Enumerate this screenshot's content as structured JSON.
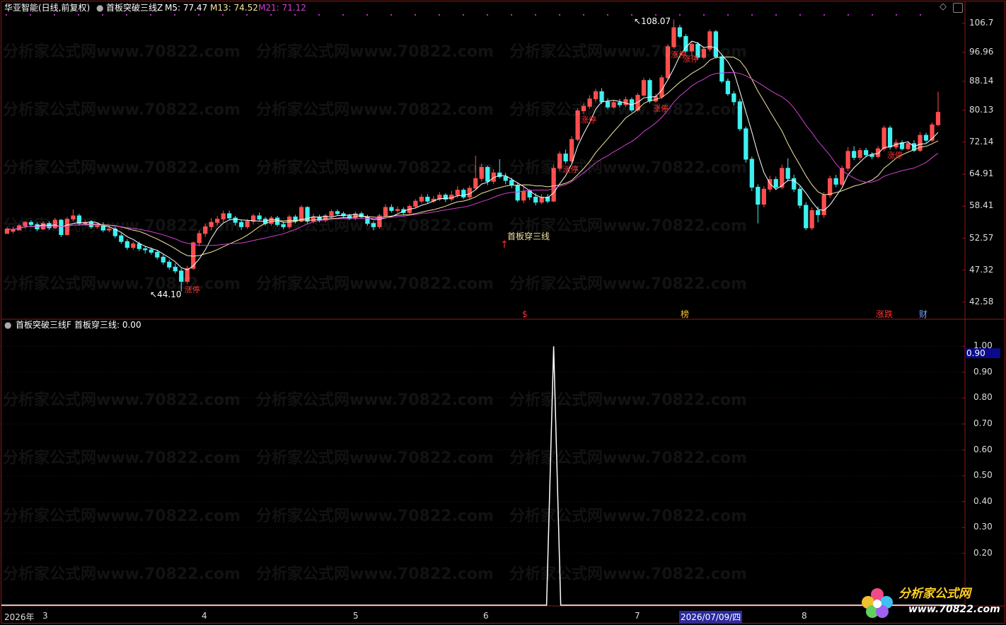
{
  "header": {
    "stock": "华亚智能(日线,前复权)",
    "indicator": "首板突破三线Z",
    "m5": "M5: 77.47",
    "m13": "M13: 74.52",
    "m21": "M21: 71.12"
  },
  "sub_header": {
    "indicator": "首板突破三线F",
    "value": "首板穿三线: 0.00"
  },
  "annotations": {
    "high": "108.07",
    "low": "44.10",
    "signal": "首板穿三线",
    "limit_up": "涨停",
    "marker_s": "$",
    "marker_bang": "榜",
    "marker_zd": "涨跌",
    "marker_cai": "财",
    "cursor_value": "0.90"
  },
  "watermark": "分析家公式网www.70822.com",
  "logo": {
    "text": "分析家公式网",
    "url": "www.70822.com"
  },
  "colors": {
    "up": "#ff4d4d",
    "down": "#3ef0f0",
    "m5": "#ffffff",
    "m13": "#f5e6a0",
    "m21": "#d040d0",
    "frame": "#8b1a1a"
  },
  "chart_data": [
    {
      "type": "candlestick",
      "title": "华亚智能(日线,前复权)",
      "ylim": [
        42.58,
        106.7
      ],
      "yticks": [
        "106.7",
        "96.96",
        "88.14",
        "80.13",
        "72.14",
        "64.91",
        "58.41",
        "52.57",
        "47.32",
        "42.58"
      ],
      "xticks": [
        "2026年",
        "3",
        "4",
        "5",
        "6",
        "7",
        "2026/07/09/四",
        "8"
      ],
      "series": [
        {
          "name": "M5",
          "last": 77.47
        },
        {
          "name": "M13",
          "last": 74.52
        },
        {
          "name": "M21",
          "last": 71.12
        }
      ],
      "candles": [
        [
          53.4,
          54.2,
          53.8,
          54.6
        ],
        [
          53.8,
          54.0,
          54.6,
          53.4
        ],
        [
          54.0,
          54.8,
          54.4,
          55.2
        ],
        [
          54.8,
          55.4,
          55.6,
          54.3
        ],
        [
          55.4,
          55.0,
          55.8,
          54.6
        ],
        [
          55.0,
          54.2,
          55.4,
          53.8
        ],
        [
          54.2,
          55.2,
          55.6,
          54.0
        ],
        [
          55.2,
          54.4,
          55.6,
          54.0
        ],
        [
          54.4,
          55.8,
          56.2,
          54.2
        ],
        [
          55.8,
          53.2,
          56.0,
          52.8
        ],
        [
          53.2,
          56.0,
          56.4,
          53.0
        ],
        [
          56.0,
          56.6,
          57.8,
          55.6
        ],
        [
          56.6,
          55.2,
          57.0,
          54.8
        ],
        [
          55.2,
          55.4,
          55.8,
          54.8
        ],
        [
          55.4,
          54.6,
          55.8,
          54.2
        ],
        [
          54.6,
          54.8,
          55.2,
          54.2
        ],
        [
          54.8,
          54.0,
          55.4,
          53.6
        ],
        [
          54.0,
          54.2,
          54.8,
          53.6
        ],
        [
          54.2,
          53.0,
          54.6,
          52.6
        ],
        [
          53.0,
          52.0,
          53.4,
          51.6
        ],
        [
          52.0,
          51.0,
          52.4,
          50.6
        ],
        [
          51.0,
          51.6,
          52.0,
          50.6
        ],
        [
          51.6,
          50.8,
          52.0,
          50.4
        ],
        [
          50.8,
          50.6,
          51.2,
          50.0
        ],
        [
          50.6,
          50.2,
          51.0,
          49.8
        ],
        [
          50.2,
          49.4,
          50.6,
          49.0
        ],
        [
          49.4,
          48.6,
          49.8,
          48.2
        ],
        [
          48.6,
          47.8,
          49.0,
          47.4
        ],
        [
          47.8,
          47.2,
          48.4,
          46.8
        ],
        [
          47.2,
          45.6,
          47.6,
          44.1
        ],
        [
          45.6,
          47.6,
          48.0,
          45.2
        ],
        [
          47.6,
          51.8,
          52.0,
          47.4
        ],
        [
          51.8,
          53.4,
          54.0,
          51.2
        ],
        [
          53.4,
          54.6,
          55.2,
          52.8
        ],
        [
          54.6,
          55.4,
          56.2,
          54.0
        ],
        [
          55.4,
          56.0,
          56.6,
          54.8
        ],
        [
          56.0,
          57.0,
          57.6,
          55.4
        ],
        [
          57.0,
          56.2,
          57.6,
          55.8
        ],
        [
          56.2,
          55.4,
          56.6,
          54.8
        ],
        [
          55.4,
          54.6,
          55.8,
          54.0
        ],
        [
          54.6,
          55.6,
          56.0,
          54.2
        ],
        [
          55.6,
          56.6,
          57.0,
          55.0
        ],
        [
          56.6,
          56.0,
          57.2,
          55.6
        ],
        [
          56.0,
          55.2,
          56.4,
          54.8
        ],
        [
          55.2,
          56.2,
          56.6,
          54.8
        ],
        [
          56.2,
          55.0,
          56.6,
          54.6
        ],
        [
          55.0,
          54.6,
          55.4,
          54.2
        ],
        [
          54.6,
          56.4,
          56.8,
          54.2
        ],
        [
          56.4,
          55.6,
          56.8,
          55.2
        ],
        [
          55.6,
          58.2,
          58.6,
          55.4
        ],
        [
          58.2,
          55.6,
          58.4,
          55.2
        ],
        [
          55.6,
          56.4,
          57.0,
          55.2
        ],
        [
          56.4,
          55.8,
          56.8,
          55.4
        ],
        [
          55.8,
          56.6,
          57.0,
          55.4
        ],
        [
          56.6,
          57.4,
          57.8,
          56.2
        ],
        [
          57.4,
          57.0,
          57.8,
          56.6
        ],
        [
          57.0,
          56.6,
          57.4,
          56.2
        ],
        [
          56.6,
          56.2,
          57.0,
          55.8
        ],
        [
          56.2,
          57.0,
          57.4,
          55.8
        ],
        [
          57.0,
          56.4,
          57.4,
          56.0
        ],
        [
          56.4,
          55.2,
          56.8,
          54.8
        ],
        [
          55.2,
          54.6,
          55.6,
          54.0
        ],
        [
          54.6,
          56.6,
          57.0,
          54.2
        ],
        [
          56.6,
          58.2,
          58.8,
          56.2
        ],
        [
          58.2,
          57.6,
          58.8,
          57.2
        ],
        [
          57.6,
          57.8,
          58.4,
          57.2
        ],
        [
          57.8,
          57.2,
          58.2,
          56.8
        ],
        [
          57.2,
          58.4,
          58.8,
          56.8
        ],
        [
          58.4,
          59.4,
          59.8,
          58.0
        ],
        [
          59.4,
          60.2,
          60.8,
          59.0
        ],
        [
          60.2,
          59.4,
          60.8,
          59.0
        ],
        [
          59.4,
          59.8,
          60.4,
          59.0
        ],
        [
          59.8,
          60.6,
          61.2,
          59.4
        ],
        [
          60.6,
          59.8,
          61.0,
          59.2
        ],
        [
          59.8,
          60.6,
          61.4,
          59.4
        ],
        [
          60.6,
          61.6,
          62.4,
          60.0
        ],
        [
          61.6,
          60.2,
          62.0,
          59.8
        ],
        [
          60.2,
          62.0,
          62.6,
          59.8
        ],
        [
          62.0,
          64.0,
          69.0,
          61.6
        ],
        [
          64.0,
          66.4,
          67.2,
          63.4
        ],
        [
          66.4,
          63.4,
          66.8,
          62.6
        ],
        [
          63.4,
          65.2,
          66.0,
          62.8
        ],
        [
          65.2,
          64.4,
          68.2,
          64.0
        ],
        [
          64.4,
          63.6,
          65.2,
          62.8
        ],
        [
          63.6,
          62.6,
          64.2,
          62.0
        ],
        [
          62.6,
          59.6,
          63.0,
          59.2
        ],
        [
          59.6,
          61.4,
          62.2,
          59.0
        ],
        [
          61.4,
          60.2,
          61.8,
          59.6
        ],
        [
          60.2,
          59.2,
          61.0,
          58.6
        ],
        [
          59.2,
          60.2,
          60.8,
          58.8
        ],
        [
          60.2,
          59.4,
          60.8,
          59.0
        ],
        [
          59.4,
          66.2,
          67.0,
          59.2
        ],
        [
          66.2,
          69.4,
          70.0,
          65.6
        ],
        [
          69.4,
          67.8,
          70.4,
          67.2
        ],
        [
          67.8,
          72.8,
          73.6,
          67.2
        ],
        [
          72.8,
          80.0,
          80.6,
          72.4
        ],
        [
          80.0,
          81.2,
          82.0,
          79.2
        ],
        [
          81.2,
          83.2,
          84.2,
          80.6
        ],
        [
          83.2,
          85.2,
          86.0,
          82.4
        ],
        [
          85.2,
          82.4,
          86.2,
          81.8
        ],
        [
          82.4,
          81.0,
          83.4,
          80.4
        ],
        [
          81.0,
          82.2,
          82.8,
          80.6
        ],
        [
          82.2,
          81.6,
          83.2,
          81.0
        ],
        [
          81.6,
          83.0,
          83.8,
          81.0
        ],
        [
          83.0,
          80.2,
          83.6,
          79.6
        ],
        [
          80.2,
          84.2,
          84.8,
          79.8
        ],
        [
          84.2,
          88.4,
          89.2,
          83.8
        ],
        [
          88.4,
          82.6,
          89.0,
          82.0
        ],
        [
          82.6,
          83.8,
          84.6,
          82.2
        ],
        [
          83.8,
          89.2,
          90.0,
          83.2
        ],
        [
          89.2,
          98.8,
          99.6,
          88.6
        ],
        [
          98.8,
          105.2,
          108.07,
          98.2
        ],
        [
          105.2,
          102.2,
          106.2,
          101.6
        ],
        [
          102.2,
          97.4,
          103.0,
          96.8
        ],
        [
          97.4,
          99.6,
          100.4,
          95.8
        ],
        [
          99.6,
          95.4,
          100.4,
          94.6
        ],
        [
          95.4,
          98.0,
          98.8,
          94.8
        ],
        [
          98.0,
          103.8,
          104.6,
          97.2
        ],
        [
          103.8,
          95.6,
          104.4,
          95.0
        ],
        [
          95.6,
          88.2,
          96.4,
          87.6
        ],
        [
          88.2,
          84.6,
          89.0,
          84.0
        ],
        [
          84.6,
          82.4,
          85.4,
          81.4
        ],
        [
          82.4,
          75.4,
          83.2,
          74.8
        ],
        [
          75.4,
          68.2,
          76.0,
          67.4
        ],
        [
          68.2,
          62.2,
          68.8,
          61.4
        ],
        [
          62.2,
          58.8,
          62.8,
          55.2
        ],
        [
          58.8,
          61.8,
          62.4,
          58.2
        ],
        [
          61.8,
          63.8,
          64.6,
          61.2
        ],
        [
          63.8,
          62.2,
          64.4,
          61.6
        ],
        [
          62.2,
          66.2,
          67.0,
          61.8
        ],
        [
          66.2,
          64.0,
          68.4,
          63.4
        ],
        [
          64.0,
          61.8,
          64.8,
          61.2
        ],
        [
          61.8,
          58.6,
          62.4,
          58.0
        ],
        [
          58.6,
          54.4,
          59.2,
          54.0
        ],
        [
          54.4,
          57.6,
          58.2,
          54.0
        ],
        [
          57.6,
          56.8,
          58.4,
          55.4
        ],
        [
          56.8,
          60.6,
          61.2,
          56.2
        ],
        [
          60.6,
          64.0,
          64.6,
          60.0
        ],
        [
          64.0,
          62.8,
          64.8,
          62.2
        ],
        [
          62.8,
          66.2,
          66.8,
          62.4
        ],
        [
          66.2,
          70.0,
          71.0,
          65.6
        ],
        [
          70.0,
          68.6,
          71.2,
          68.0
        ],
        [
          68.6,
          70.2,
          70.8,
          68.0
        ],
        [
          70.2,
          69.2,
          70.8,
          68.6
        ],
        [
          69.2,
          68.8,
          69.8,
          68.2
        ],
        [
          68.8,
          70.6,
          71.2,
          68.4
        ],
        [
          70.6,
          75.6,
          76.2,
          70.0
        ],
        [
          75.6,
          71.0,
          76.2,
          70.4
        ],
        [
          71.0,
          72.0,
          72.8,
          70.4
        ],
        [
          72.0,
          70.6,
          72.6,
          70.2
        ],
        [
          70.6,
          71.8,
          72.4,
          70.2
        ],
        [
          71.8,
          70.2,
          72.6,
          69.8
        ],
        [
          70.2,
          73.8,
          74.6,
          69.8
        ],
        [
          73.8,
          72.6,
          74.4,
          72.0
        ],
        [
          72.6,
          76.4,
          77.0,
          72.2
        ],
        [
          76.4,
          79.6,
          85.2,
          76.0
        ]
      ]
    },
    {
      "type": "line",
      "title": "首板突破三线F",
      "ylim": [
        0,
        1.05
      ],
      "yticks": [
        "1.00",
        "0.90",
        "0.80",
        "0.70",
        "0.60",
        "0.50",
        "0.40",
        "0.30",
        "0.20"
      ],
      "series": [
        {
          "name": "首板穿三线",
          "spike_index": 91,
          "spike_value": 1.0,
          "last": 0.0
        }
      ]
    }
  ]
}
